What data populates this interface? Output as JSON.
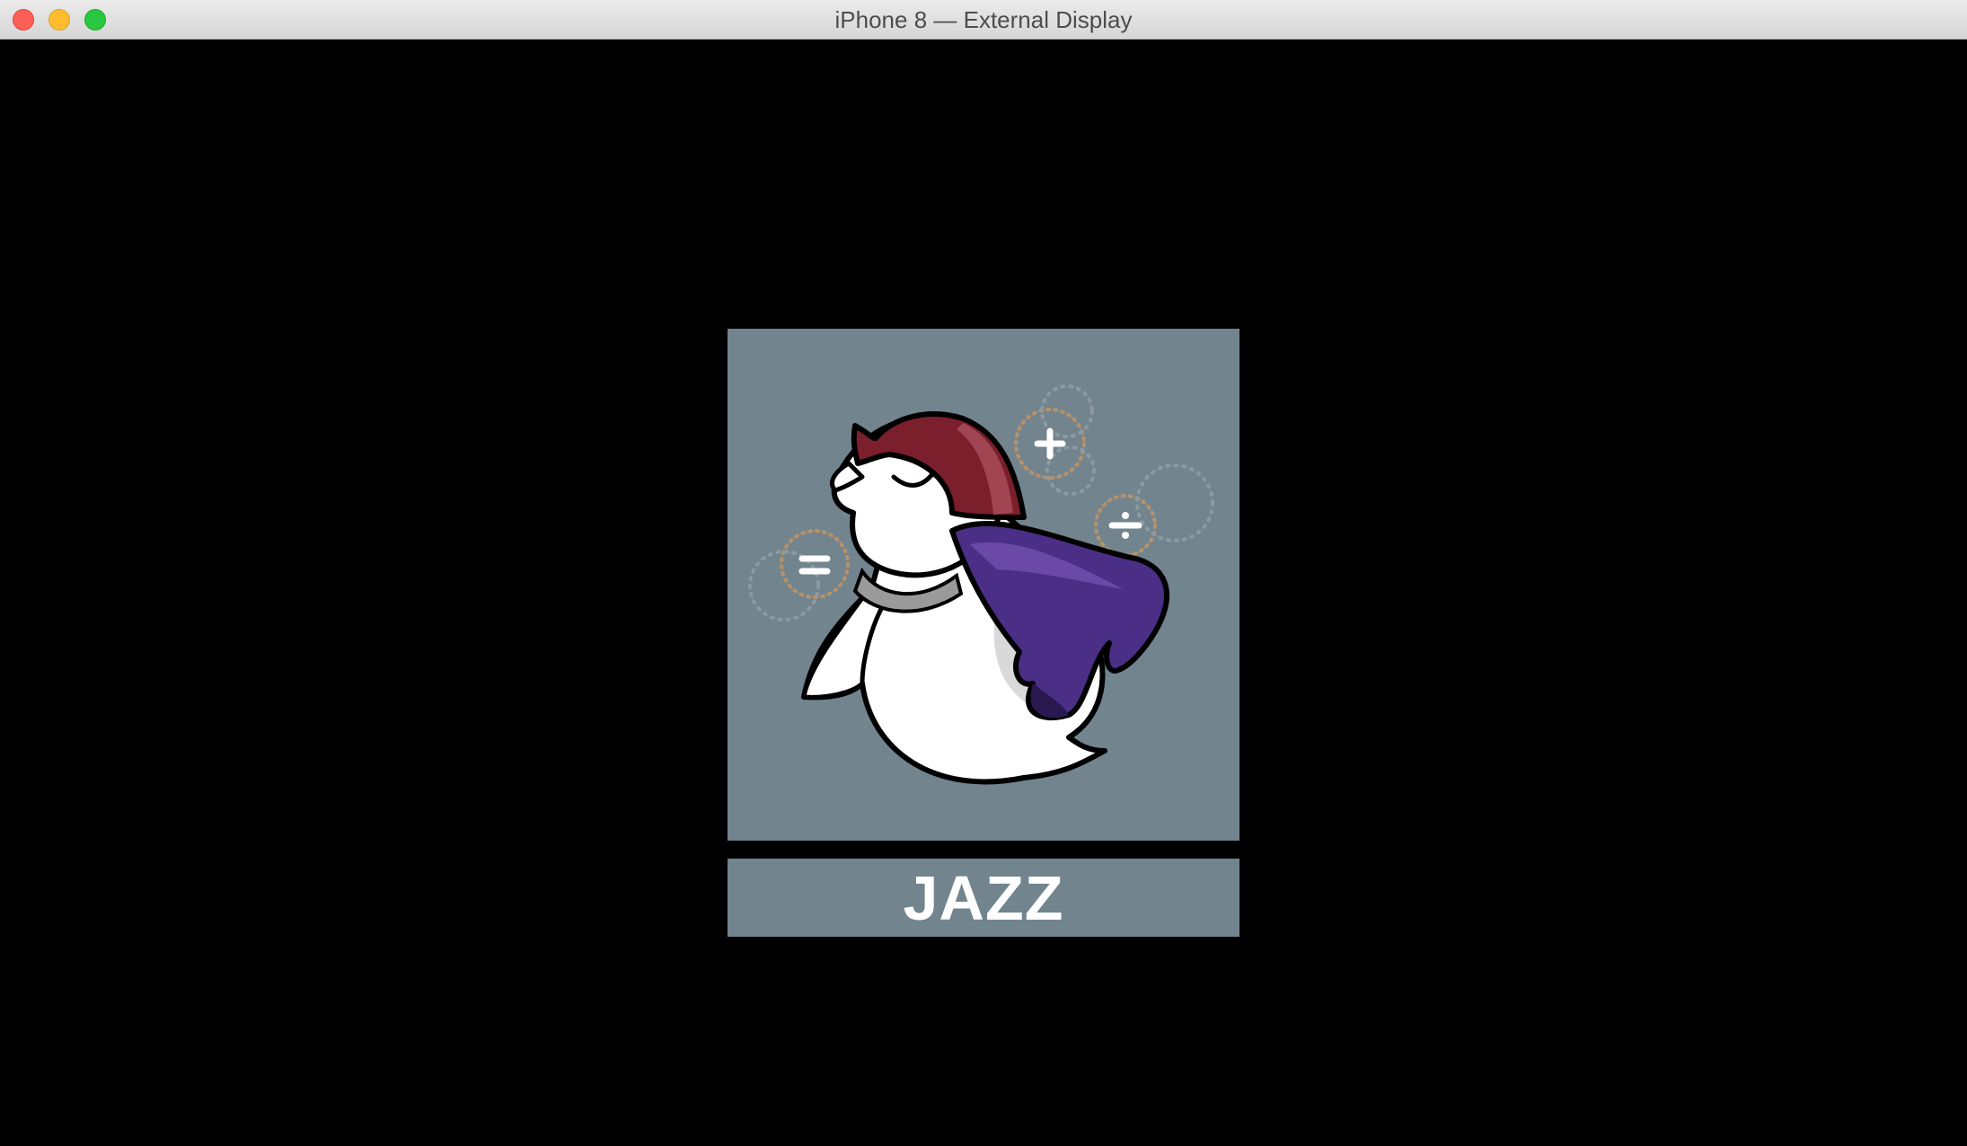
{
  "window": {
    "title": "iPhone 8 — External Display"
  },
  "display": {
    "label": "JAZZ",
    "artwork_icon": "caped-bird-mascot-icon",
    "colors": {
      "panel": "#72848e",
      "background": "#000000",
      "label_text": "#ffffff",
      "cap": "#7a1f2b",
      "cape": "#4b2f86"
    }
  }
}
